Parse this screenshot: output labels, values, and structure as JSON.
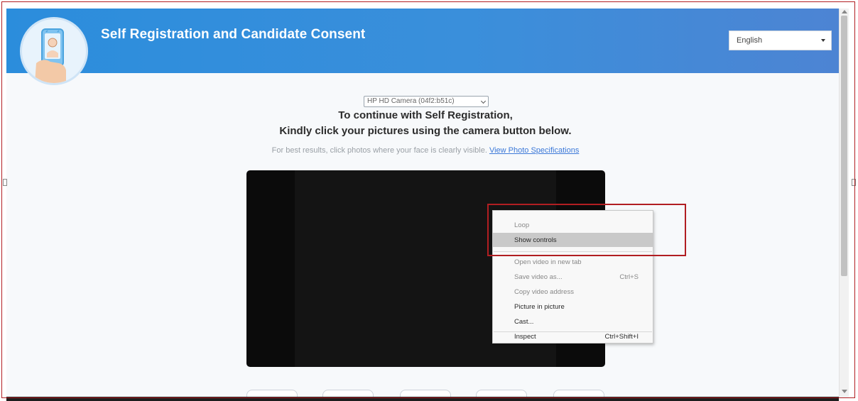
{
  "header": {
    "title": "Self Registration and Candidate Consent",
    "logo_icon": "selfie-phone-icon",
    "language": {
      "selected": "English",
      "icon": "caret-down-icon"
    }
  },
  "main": {
    "camera_select": {
      "selected": "HP HD Camera (04f2:b51c)"
    },
    "instruction_line1": "To continue with Self Registration,",
    "instruction_line2": "Kindly click your pictures using the camera button below.",
    "hint_text": "For best results, click photos where your face is clearly visible.",
    "hint_link": "View Photo Specifications"
  },
  "context_menu": {
    "items": [
      {
        "label": "Loop",
        "shortcut": "",
        "enabled": false,
        "hovered": false
      },
      {
        "label": "Show controls",
        "shortcut": "",
        "enabled": true,
        "hovered": true
      },
      {
        "label": "Open video in new tab",
        "shortcut": "",
        "enabled": false,
        "hovered": false
      },
      {
        "label": "Save video as...",
        "shortcut": "Ctrl+S",
        "enabled": false,
        "hovered": false
      },
      {
        "label": "Copy video address",
        "shortcut": "",
        "enabled": false,
        "hovered": false
      },
      {
        "label": "Picture in picture",
        "shortcut": "",
        "enabled": true,
        "hovered": false
      },
      {
        "label": "Cast...",
        "shortcut": "",
        "enabled": true,
        "hovered": false
      },
      {
        "label": "Inspect",
        "shortcut": "Ctrl+Shift+I",
        "enabled": true,
        "hovered": false
      }
    ]
  },
  "colors": {
    "header_start": "#2b8ddc",
    "header_end": "#4d84d3",
    "highlight": "#b11e22",
    "link": "#3b78d8"
  }
}
